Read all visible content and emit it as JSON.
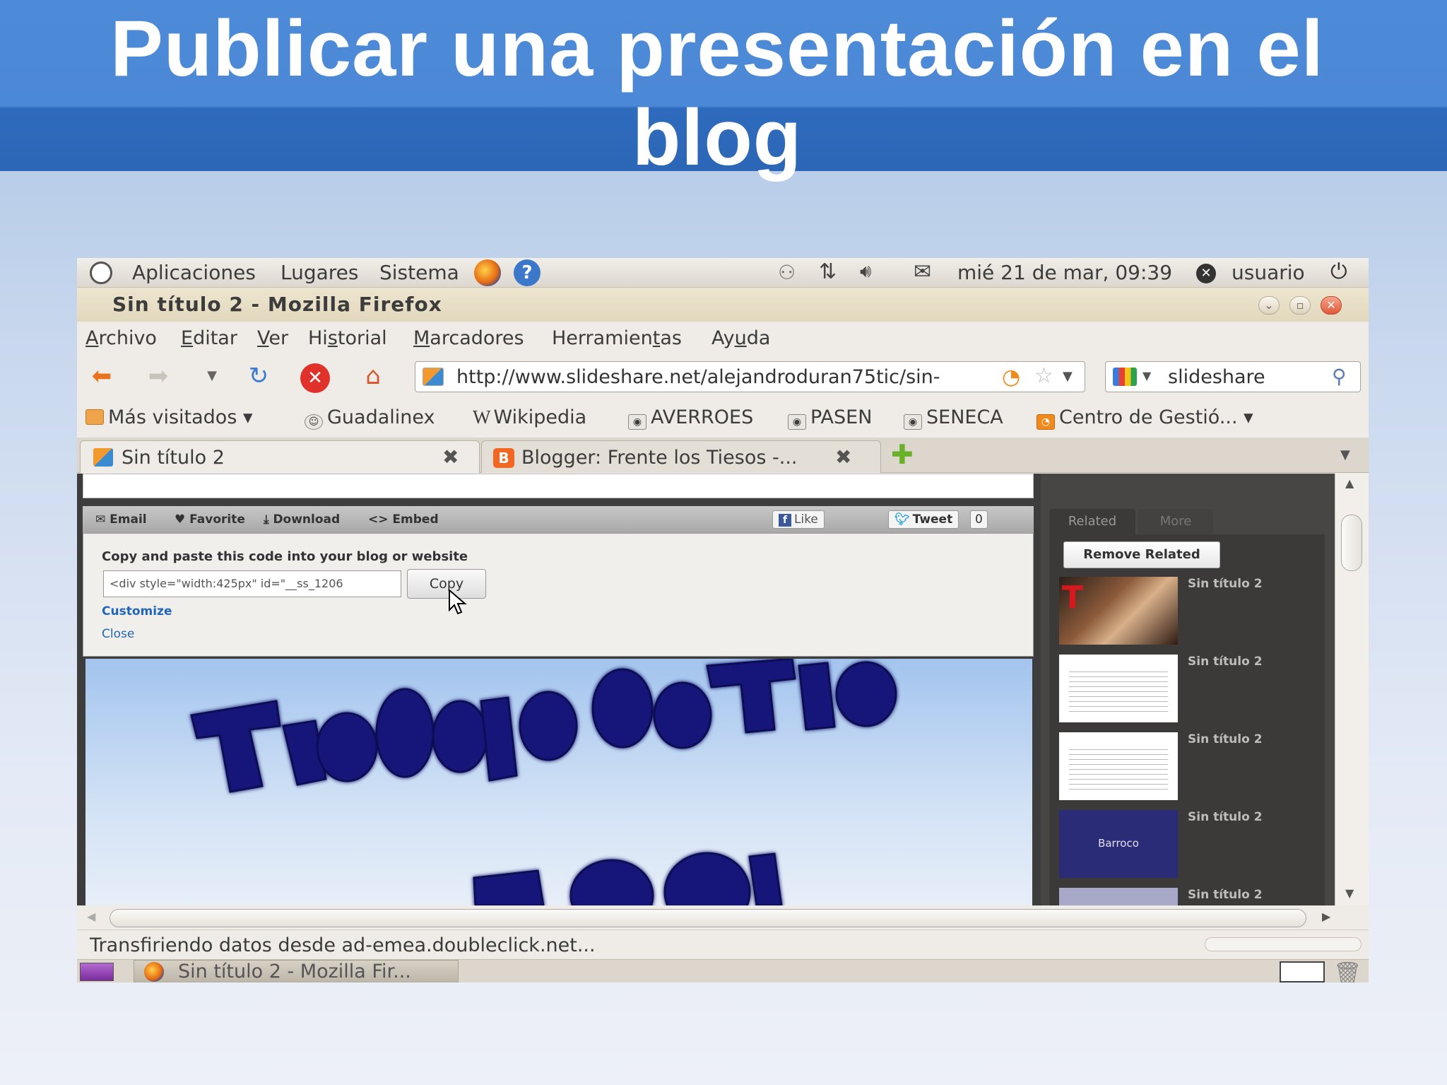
{
  "slide": {
    "title": "Publicar una presentación en el blog"
  },
  "gnome_panel": {
    "menus": [
      "Aplicaciones",
      "Lugares",
      "Sistema"
    ],
    "datetime": "mié 21 de mar, 09:39",
    "user": "usuario"
  },
  "window": {
    "title": "Sin título 2 - Mozilla Firefox"
  },
  "menubar": {
    "items": [
      {
        "pre": "",
        "u": "A",
        "post": "rchivo"
      },
      {
        "pre": "",
        "u": "E",
        "post": "ditar"
      },
      {
        "pre": "",
        "u": "V",
        "post": "er"
      },
      {
        "pre": "Hi",
        "u": "s",
        "post": "torial"
      },
      {
        "pre": "",
        "u": "M",
        "post": "arcadores"
      },
      {
        "pre": "Herramien",
        "u": "t",
        "post": "as"
      },
      {
        "pre": "Ay",
        "u": "u",
        "post": "da"
      }
    ]
  },
  "navbar": {
    "url": "http://www.slideshare.net/alejandroduran75tic/sin-",
    "search_value": "slideshare"
  },
  "bookmarks": {
    "most_visited": "Más visitados ▾",
    "items": [
      "Guadalinex",
      "Wikipedia",
      "AVERROES",
      "PASEN",
      "SENECA"
    ],
    "last": "Centro de Gestió... ▾"
  },
  "tabs": [
    {
      "label": "Sin título 2"
    },
    {
      "label": "Blogger: Frente los Tiesos -..."
    }
  ],
  "share_toolbar": {
    "email": "Email",
    "favorite": "Favorite",
    "download": "Download",
    "embed": "Embed",
    "like": "Like",
    "tweet": "Tweet",
    "tweet_count": "0"
  },
  "embed_panel": {
    "instruction": "Copy and paste this code into your blog or website",
    "code_value": "<div style=\"width:425px\" id=\"__ss_1206",
    "copy_label": "Copy",
    "customize": "Customize",
    "close": "Close"
  },
  "sidebar": {
    "tab_related": "Related",
    "tab_more": "More",
    "remove_related": "Remove Related",
    "items": [
      {
        "title": "Sin título 2"
      },
      {
        "title": "Sin título 2"
      },
      {
        "title": "Sin título 2"
      },
      {
        "title": "Sin título 2",
        "thumb_text": "Barroco"
      },
      {
        "title": "Sin título 2"
      }
    ]
  },
  "statusbar": {
    "text": "Transfiriendo datos desde ad-emea.doubleclick.net..."
  },
  "taskbar": {
    "task_label": "Sin título 2 - Mozilla Fir..."
  },
  "colors": {
    "slide_title_bar": "#4b88d6",
    "slideshare_sidebar": "#484644",
    "link_blue": "#2266bb"
  }
}
